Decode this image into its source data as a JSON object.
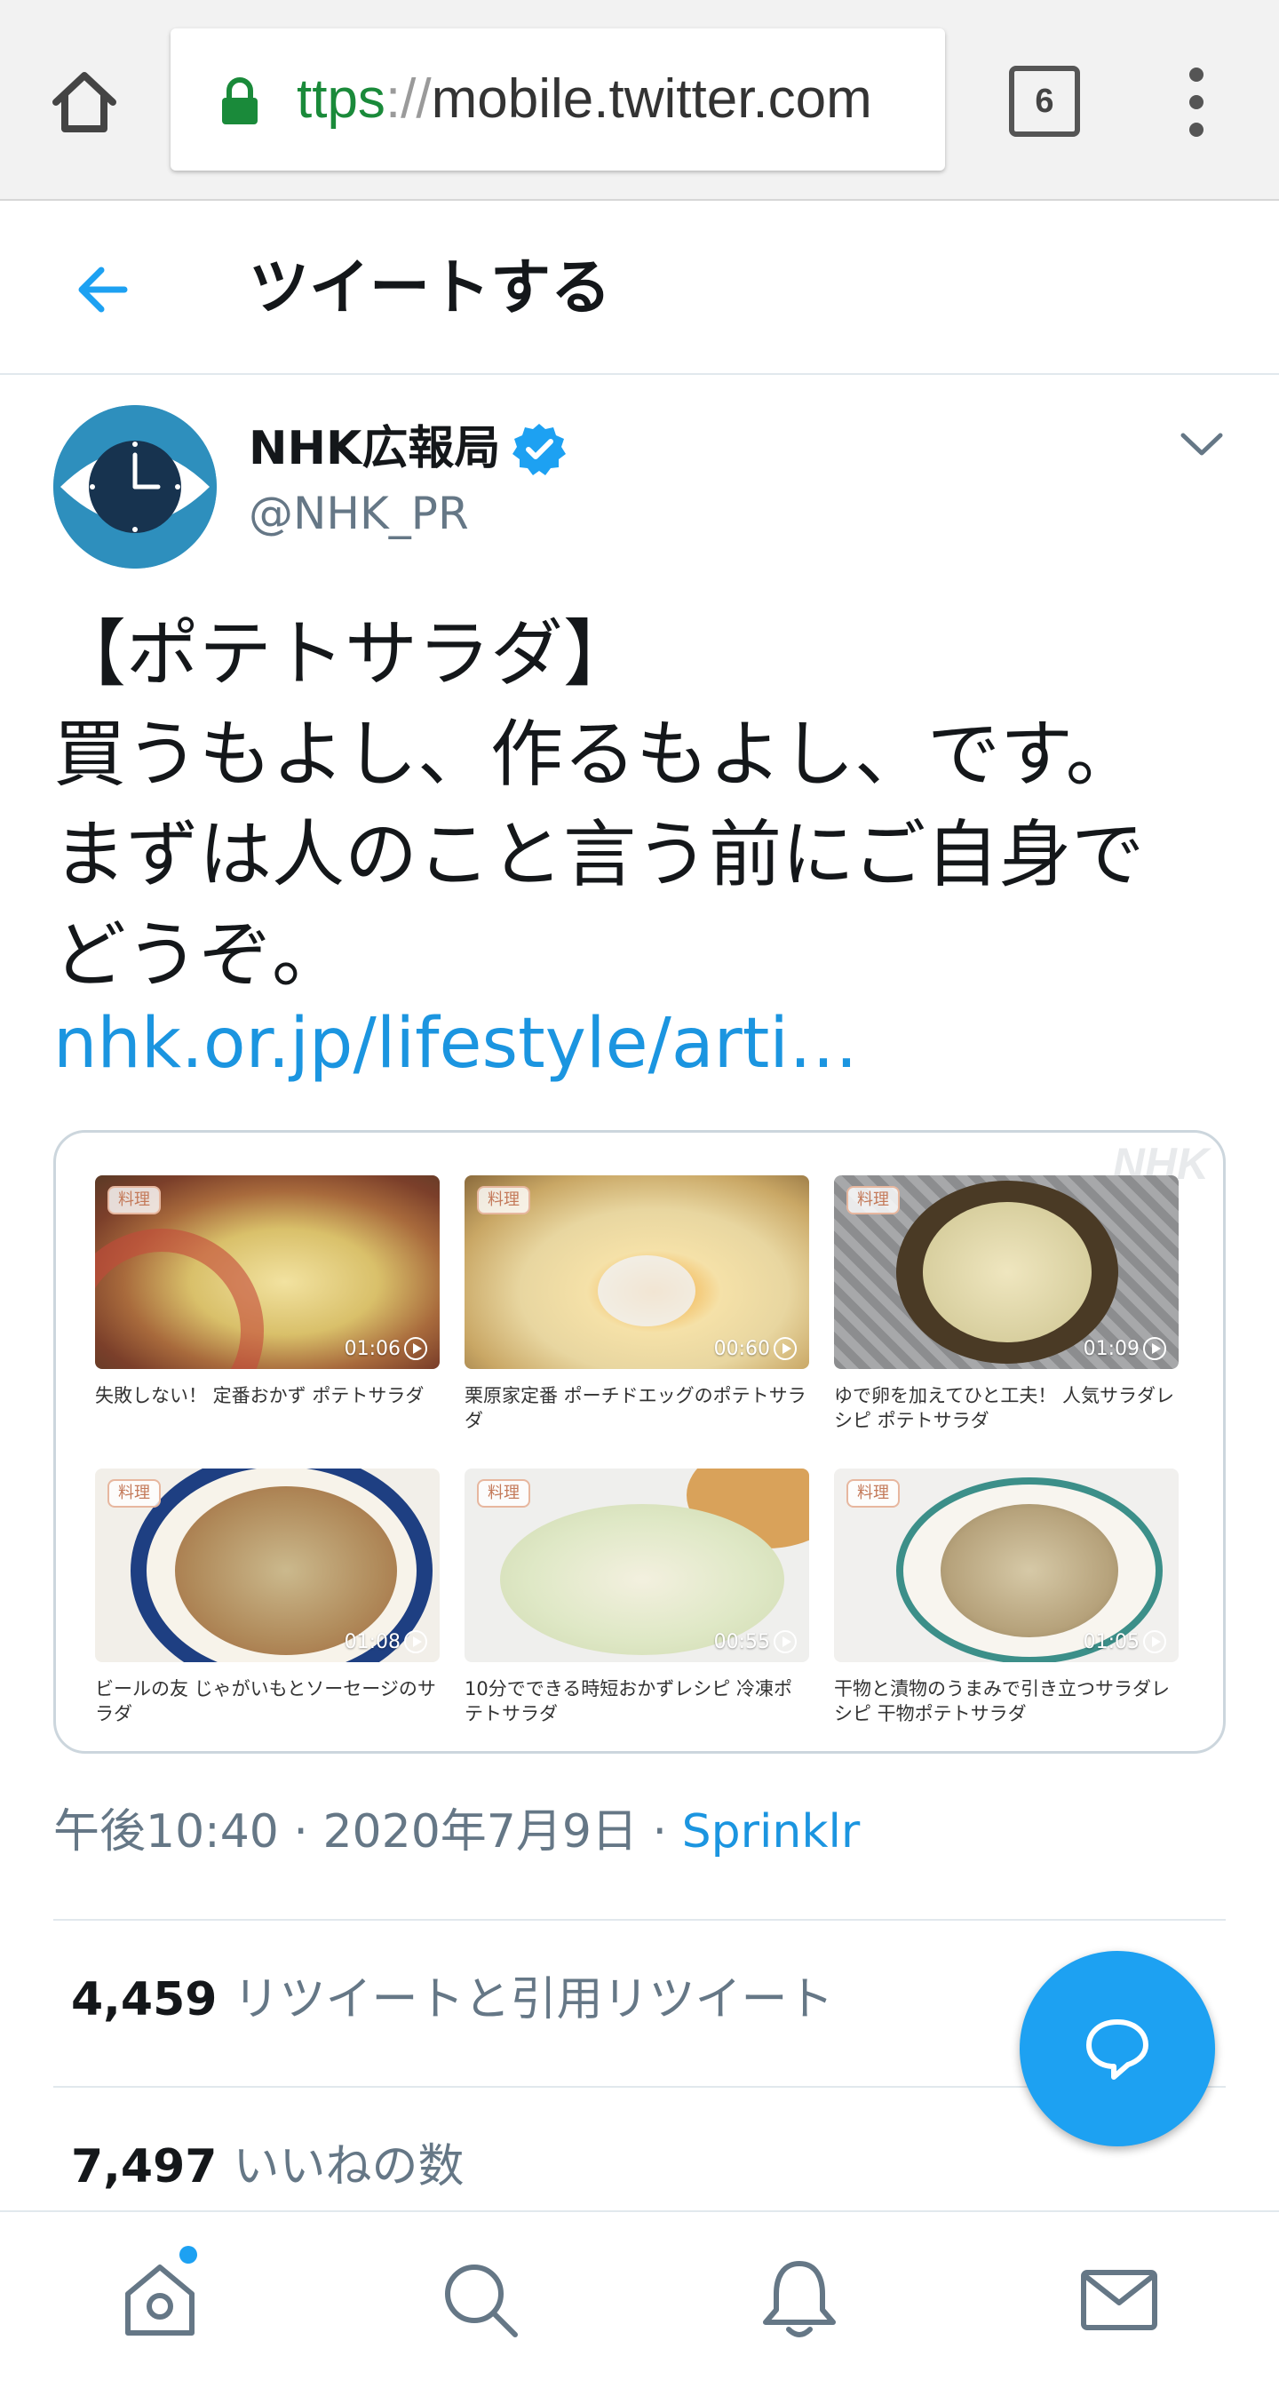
{
  "browser": {
    "url_scheme": "ttps",
    "url_separator": "://",
    "url_host": "mobile.twitter.com",
    "tab_count": "6"
  },
  "header": {
    "title": "ツイートする"
  },
  "tweet": {
    "display_name": "NHK広報局",
    "handle": "@NHK_PR",
    "text": "【ポテトサラダ】\n買うもよし、作るもよし、です。\nまずは人のこと言う前にご自身で\nどうぞ。",
    "link": "nhk.or.jp/lifestyle/arti…",
    "time": "午後10:40",
    "date": "2020年7月9日",
    "dot": "·",
    "source": "Sprinklr"
  },
  "card": {
    "watermark": "NHK",
    "tiles": [
      {
        "tag": "料理",
        "duration": "01:06",
        "caption": "失敗しない！ 定番おかず ポテトサラダ"
      },
      {
        "tag": "料理",
        "duration": "00:60",
        "caption": "栗原家定番 ポーチドエッグのポテトサラダ"
      },
      {
        "tag": "料理",
        "duration": "01:09",
        "caption": "ゆで卵を加えてひと工夫！ 人気サラダレシピ ポテトサラダ"
      },
      {
        "tag": "料理",
        "duration": "01:08",
        "caption": "ビールの友 じゃがいもとソーセージのサラダ"
      },
      {
        "tag": "料理",
        "duration": "00:55",
        "caption": "10分でできる時短おかずレシピ 冷凍ポテトサラダ"
      },
      {
        "tag": "料理",
        "duration": "01:05",
        "caption": "干物と漬物のうまみで引き立つサラダレシピ 干物ポテトサラダ"
      }
    ]
  },
  "stats": {
    "retweets_count": "4,459",
    "retweets_label": "リツイートと引用リツイート",
    "likes_count": "7,497",
    "likes_label": "いいねの数"
  },
  "colors": {
    "accent": "#1da1f2",
    "link": "#1b95e0",
    "secondary_text": "#657786"
  },
  "icons": {
    "home": "home-icon",
    "lock": "lock-icon",
    "back": "arrow-left-icon",
    "verified": "verified-badge-icon",
    "caret": "chevron-down-icon",
    "compose": "reply-bubble-icon",
    "nav": [
      "home-icon",
      "search-icon",
      "bell-icon",
      "envelope-icon"
    ]
  }
}
